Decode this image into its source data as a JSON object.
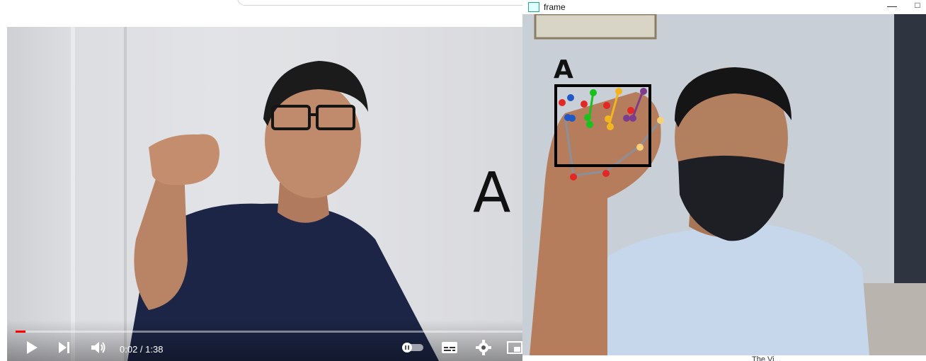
{
  "video_player": {
    "overlay_letter": "A",
    "current_time": "0:02",
    "duration": "1:38",
    "time_display": "0:02 / 1:38",
    "progress_fraction": 0.02,
    "accent_color": "#ff0000",
    "icons": [
      "play-icon",
      "next-icon",
      "volume-icon",
      "autoplay-toggle-icon",
      "subtitles-icon",
      "settings-icon",
      "miniplayer-icon"
    ]
  },
  "frame_window": {
    "title": "frame",
    "detected_sign": "A",
    "bottom_peek_text": "The Vi..."
  }
}
